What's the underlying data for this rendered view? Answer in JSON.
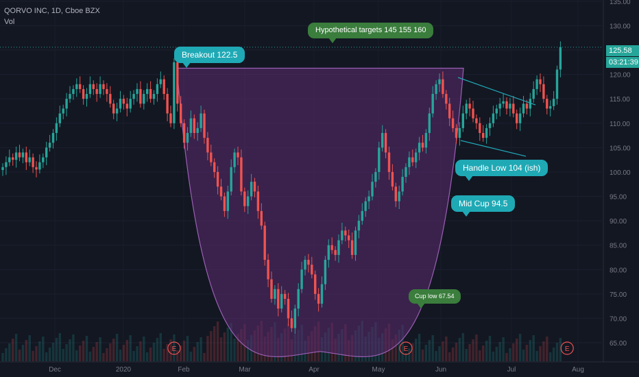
{
  "header": {
    "title": "QORVO INC, 1D, Cboe BZX",
    "sub": "Vol"
  },
  "annotations": {
    "breakout": "Breakout 122.5",
    "targets": "Hypothetical targets  145 155 160",
    "handle_low": "Handle Low 104 (ish)",
    "mid_cup": "Mid Cup 94.5",
    "cup_low": "Cup low  67.54"
  },
  "price_axis": {
    "last_price": "125.58",
    "countdown": "03:21:39"
  },
  "earnings_marker": "E",
  "colors": {
    "up": "#26a69a",
    "down": "#ef5350",
    "cup_fill": "#5b2c6f",
    "cup_line": "#9c5fb5",
    "teal": "#1fa9b5",
    "green_bubble": "#3a7d3c",
    "price_tag": "#26a69a",
    "bg": "#131722"
  },
  "chart_data": {
    "type": "candlestick",
    "symbol": "QORVO INC",
    "interval": "1D",
    "exchange": "Cboe BZX",
    "yticks": [
      65,
      70,
      75,
      80,
      85,
      90,
      95,
      100,
      105,
      110,
      115,
      120,
      125,
      130,
      135
    ],
    "ytick_labels": [
      "65.00",
      "70.00",
      "75.00",
      "80.00",
      "85.00",
      "90.00",
      "95.00",
      "100.00",
      "105.00",
      "110.00",
      "115.00",
      "120.00",
      "125.00",
      "130.00",
      "135.00"
    ],
    "xtick_labels": [
      "Dec",
      "2020",
      "Feb",
      "Mar",
      "Apr",
      "May",
      "Jun",
      "Jul",
      "Aug"
    ],
    "ylim": [
      62,
      136
    ],
    "last_price": 125.58,
    "closes": [
      101,
      102,
      103,
      102.5,
      104,
      103,
      104,
      102,
      103,
      101,
      100.5,
      102,
      103,
      105,
      106,
      108,
      110,
      112,
      113,
      115,
      116,
      117,
      118,
      117,
      115,
      116,
      118,
      117,
      116,
      118,
      117,
      116,
      114,
      112,
      113,
      115,
      114,
      113,
      115,
      116,
      117,
      114,
      116,
      117,
      115,
      116,
      118,
      119,
      116,
      112,
      110,
      122.5,
      114,
      110,
      106,
      108,
      111,
      108,
      109,
      112,
      107,
      104,
      102,
      100,
      97,
      95,
      92,
      96,
      101,
      104,
      103,
      96,
      93,
      95,
      98,
      96,
      92,
      89,
      82,
      78,
      74,
      76,
      72,
      75,
      74,
      70,
      68,
      72,
      76,
      80,
      82,
      81,
      79,
      75,
      73,
      77,
      82,
      85,
      84,
      83,
      86,
      88,
      87,
      86,
      83,
      88,
      90,
      92,
      94,
      95,
      98,
      100,
      105,
      108,
      104,
      100,
      97,
      94,
      96,
      99,
      101,
      103,
      102,
      104,
      106,
      105,
      108,
      112,
      116,
      118,
      119,
      116,
      114,
      111,
      109,
      107,
      109,
      112,
      114,
      113,
      111,
      110,
      108,
      107,
      109,
      110,
      112,
      113,
      114,
      114.5,
      113,
      114,
      112,
      110,
      112,
      114,
      113,
      115,
      117,
      119,
      118,
      115,
      113,
      113.5,
      115,
      121,
      125.58
    ],
    "cup": {
      "rim_price": 121,
      "bottom_price": 63.2
    },
    "earnings_markers_at_index": [
      51,
      120,
      168
    ],
    "horizontal_line": 125.58
  }
}
